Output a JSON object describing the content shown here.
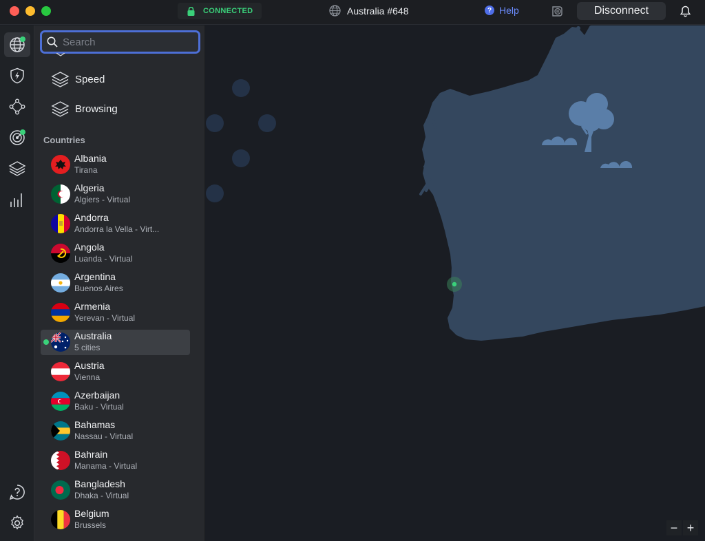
{
  "titlebar": {
    "status": "CONNECTED",
    "server": "Australia #648",
    "help_label": "Help",
    "disconnect_label": "Disconnect"
  },
  "search": {
    "placeholder": "Search",
    "value": ""
  },
  "categories": [
    {
      "label": "Speed",
      "icon": "layers-icon"
    },
    {
      "label": "Browsing",
      "icon": "layers-icon"
    }
  ],
  "countries_title": "Countries",
  "countries": [
    {
      "name": "Albania",
      "sub": "Tirana"
    },
    {
      "name": "Algeria",
      "sub": "Algiers - Virtual"
    },
    {
      "name": "Andorra",
      "sub": "Andorra la Vella - Virt..."
    },
    {
      "name": "Angola",
      "sub": "Luanda - Virtual"
    },
    {
      "name": "Argentina",
      "sub": "Buenos Aires"
    },
    {
      "name": "Armenia",
      "sub": "Yerevan - Virtual"
    },
    {
      "name": "Australia",
      "sub": "5 cities",
      "selected": true
    },
    {
      "name": "Austria",
      "sub": "Vienna"
    },
    {
      "name": "Azerbaijan",
      "sub": "Baku - Virtual"
    },
    {
      "name": "Bahamas",
      "sub": "Nassau - Virtual"
    },
    {
      "name": "Bahrain",
      "sub": "Manama - Virtual"
    },
    {
      "name": "Bangladesh",
      "sub": "Dhaka - Virtual"
    },
    {
      "name": "Belgium",
      "sub": "Brussels"
    }
  ],
  "zoom": {
    "out": "−",
    "in": "+"
  },
  "colors": {
    "accent_green": "#3ad17a",
    "focus_blue": "#4d6fd6",
    "help_blue": "#6b8cff",
    "land": "#34475e",
    "ocean": "#1a1d23"
  }
}
